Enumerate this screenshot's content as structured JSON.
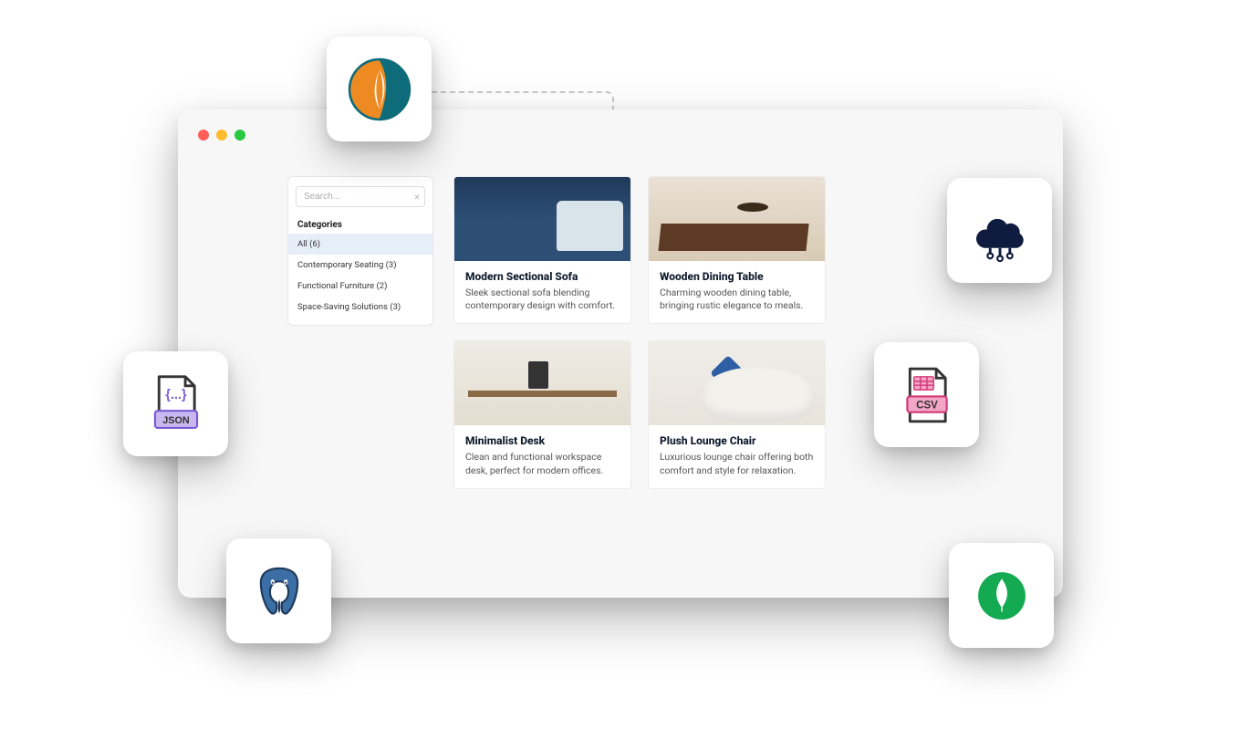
{
  "sidebar": {
    "search_placeholder": "Search...",
    "heading": "Categories",
    "items": [
      {
        "label": "All (6)",
        "active": true
      },
      {
        "label": "Contemporary Seating (3)",
        "active": false
      },
      {
        "label": "Functional Furniture (2)",
        "active": false
      },
      {
        "label": "Space-Saving Solutions (3)",
        "active": false
      }
    ]
  },
  "products": [
    {
      "title": "Modern Sectional Sofa",
      "desc": "Sleek sectional sofa blending contemporary design with comfort.",
      "img": "sofa"
    },
    {
      "title": "Wooden Dining Table",
      "desc": "Charming wooden dining table, bringing rustic elegance to meals.",
      "img": "table"
    },
    {
      "title": "Minimalist Desk",
      "desc": "Clean and functional workspace desk, perfect for modern offices.",
      "img": "desk"
    },
    {
      "title": "Plush Lounge Chair",
      "desc": "Luxurious lounge chair offering both comfort and style for relaxation.",
      "img": "chair"
    }
  ],
  "integrations": {
    "mysql": "MySQL",
    "cloud": "Cloud",
    "csv": "CSV",
    "json": "JSON",
    "postgres": "PostgreSQL",
    "mongo": "MongoDB"
  },
  "window": {
    "close": "close",
    "minimize": "minimize",
    "maximize": "maximize"
  }
}
